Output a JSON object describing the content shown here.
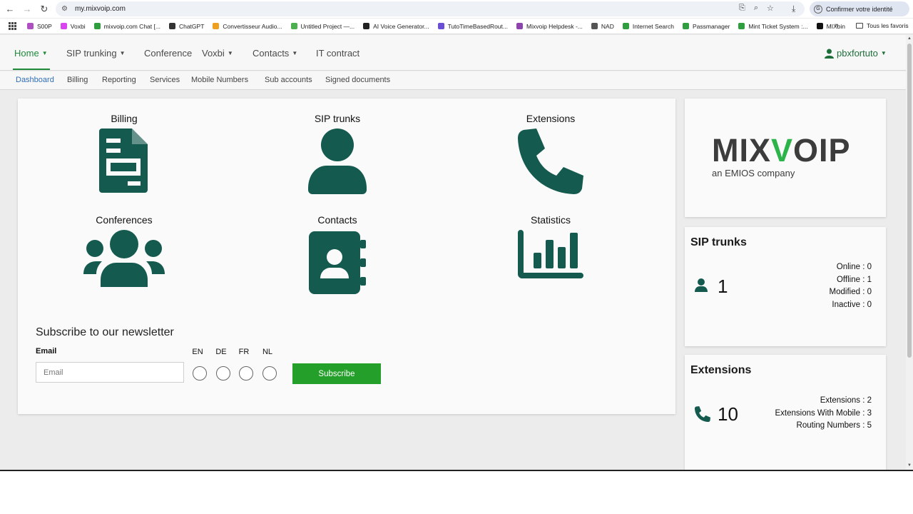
{
  "browser": {
    "url": "my.mixvoip.com",
    "profile_button": "Confirmer votre identité",
    "bookmarks": [
      {
        "label": "S00P",
        "color": "#b04fc4"
      },
      {
        "label": "Voxbi",
        "color": "#d946ef"
      },
      {
        "label": "mixvoip.com Chat [...",
        "color": "#2e9e3e"
      },
      {
        "label": "ChatGPT",
        "color": "#333333"
      },
      {
        "label": "Convertisseur Audio...",
        "color": "#f0a020"
      },
      {
        "label": "Untitled Project —...",
        "color": "#4caf50"
      },
      {
        "label": "AI Voice Generator...",
        "color": "#222222"
      },
      {
        "label": "TutoTimeBasedRout...",
        "color": "#6a4fd6"
      },
      {
        "label": "Mixvoip Helpdesk -...",
        "color": "#8e44ad"
      },
      {
        "label": "NAD",
        "color": "#555555"
      },
      {
        "label": "Internet Search",
        "color": "#2e9e3e"
      },
      {
        "label": "Passmanager",
        "color": "#2e9e3e"
      },
      {
        "label": "Mint Ticket System :...",
        "color": "#2e9e3e"
      },
      {
        "label": "MIXbin",
        "color": "#111111"
      }
    ],
    "more_chevron": "»",
    "all_bookmarks": "Tous les favoris"
  },
  "nav": {
    "items": [
      {
        "label": "Home",
        "caret": true,
        "active": true
      },
      {
        "label": "SIP trunking",
        "caret": true
      },
      {
        "label": "Conference",
        "caret": false
      },
      {
        "label": "Voxbi",
        "caret": true
      },
      {
        "label": "Contacts",
        "caret": true
      },
      {
        "label": "IT contract",
        "caret": false
      }
    ],
    "user": "pbxfortuto"
  },
  "subnav": [
    "Dashboard",
    "Billing",
    "Reporting",
    "Services",
    "Mobile Numbers",
    "Sub accounts",
    "Signed documents"
  ],
  "tiles": [
    {
      "label": "Billing",
      "icon": "invoice-icon"
    },
    {
      "label": "SIP trunks",
      "icon": "user-icon"
    },
    {
      "label": "Extensions",
      "icon": "phone-icon"
    },
    {
      "label": "Conferences",
      "icon": "users-icon"
    },
    {
      "label": "Contacts",
      "icon": "address-book-icon"
    },
    {
      "label": "Statistics",
      "icon": "bar-chart-icon"
    }
  ],
  "newsletter": {
    "title": "Subscribe to our newsletter",
    "email_label": "Email",
    "email_placeholder": "Email",
    "languages": [
      "EN",
      "DE",
      "FR",
      "NL"
    ],
    "button": "Subscribe"
  },
  "logo": {
    "text_pre": "MIX",
    "text_x": "V",
    "text_post": "OIP",
    "tagline": "an EMIOS company"
  },
  "sip_trunks": {
    "title": "SIP trunks",
    "count": "1",
    "stats": [
      "Online : 0",
      "Offline : 1",
      "Modified : 0",
      "Inactive : 0"
    ]
  },
  "extensions": {
    "title": "Extensions",
    "count": "10",
    "stats": [
      "Extensions : 2",
      "Extensions With Mobile : 3",
      "Routing Numbers : 5"
    ]
  },
  "colors": {
    "icon": "#145a4e",
    "accent": "#1e8a3a",
    "subscribe": "#24a02a",
    "logo_x": "#2cb34a"
  }
}
